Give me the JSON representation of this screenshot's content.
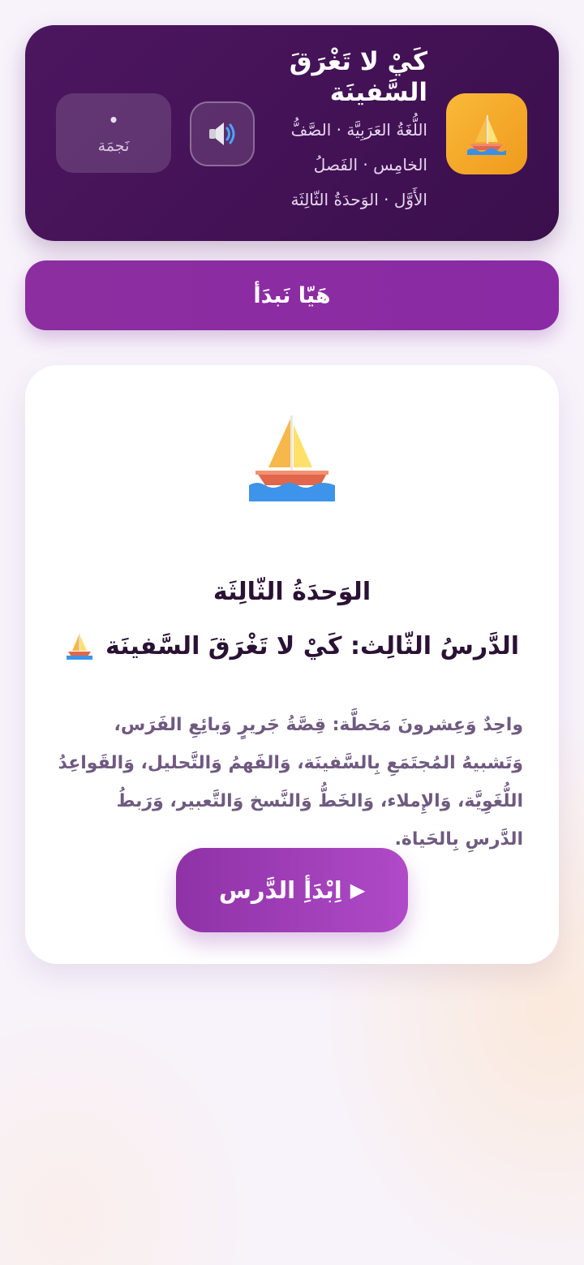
{
  "header": {
    "title": "كَيْ لا تَغْرَقَ السَّفينَة",
    "subtitle_lines": [
      "اللُّغَةُ العَرَبِيَّة · الصَّفُّ",
      "الخامِس · الفَصلُ",
      "الأَوَّل · الوَحدَةُ الثّالِثَة"
    ],
    "stars": {
      "count": "•",
      "label": "نَجمَة"
    },
    "icons": {
      "app": "sailboat-icon",
      "sound": "speaker-icon"
    }
  },
  "start_bar": {
    "label": "هَيّا نَبدَأ"
  },
  "lesson": {
    "unit": "الوَحدَةُ الثّالِثَة",
    "title": "الدَّرسُ الثّالِث: كَيْ لا تَغْرَقَ السَّفينَة",
    "description": "واحِدٌ وَعِشرونَ مَحَطَّة: قِصَّةُ جَريرٍ وَبائِعِ الفَرَس، وَتَشبيهُ المُجتَمَعِ بِالسَّفينَة، وَالفَهمُ وَالتَّحليل، وَالقَواعِدُ اللُّغَوِيَّة، وَالإِملاء، وَالخَطُّ وَالنَّسخ وَالتَّعبير، وَرَبطُ الدَّرسِ بِالحَياة.",
    "begin_button": "اِبْدَأِ الدَّرس",
    "begin_glyph": "▶"
  },
  "colors": {
    "header_bg": "#4d1660",
    "accent_purple": "#8c2ea0",
    "app_icon_orange": "#f5a623",
    "title_text": "#2a1234",
    "description_text": "#6f5a80"
  }
}
